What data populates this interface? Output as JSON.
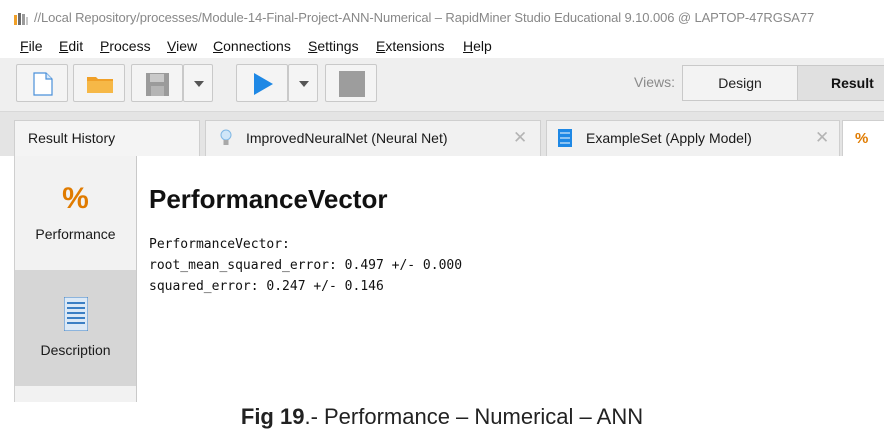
{
  "window": {
    "title": "//Local Repository/processes/Module-14-Final-Project-ANN-Numerical – RapidMiner Studio Educational 9.10.006 @ LAPTOP-47RGSA77"
  },
  "menu": [
    {
      "u": "F",
      "rest": "ile"
    },
    {
      "u": "E",
      "rest": "dit"
    },
    {
      "u": "P",
      "rest": "rocess"
    },
    {
      "u": "V",
      "rest": "iew"
    },
    {
      "u": "C",
      "rest": "onnections"
    },
    {
      "u": "S",
      "rest": "ettings"
    },
    {
      "u": "E",
      "rest": "xtensions"
    },
    {
      "u": "H",
      "rest": "elp"
    }
  ],
  "toolbar": {
    "views_label": "Views:",
    "design_label": "Design",
    "results_label": "Result"
  },
  "tabs": {
    "result_history": "Result History",
    "neural_net": "ImprovedNeuralNet (Neural Net)",
    "example_set": "ExampleSet (Apply Model)",
    "close_symbol": "✕",
    "percent_symbol": "%"
  },
  "side_panel": {
    "performance_label": "Performance",
    "description_label": "Description",
    "percent_symbol": "%"
  },
  "content": {
    "title": "PerformanceVector",
    "lines": [
      "PerformanceVector:",
      "root_mean_squared_error: 0.497 +/- 0.000",
      "squared_error: 0.247 +/- 0.146"
    ]
  },
  "caption": {
    "bold": "Fig 19",
    "rest": ".- Performance – Numerical – ANN"
  },
  "colors": {
    "accent_blue": "#1e88e5",
    "folder_orange": "#f0a028",
    "percent_orange": "#e07b00"
  }
}
